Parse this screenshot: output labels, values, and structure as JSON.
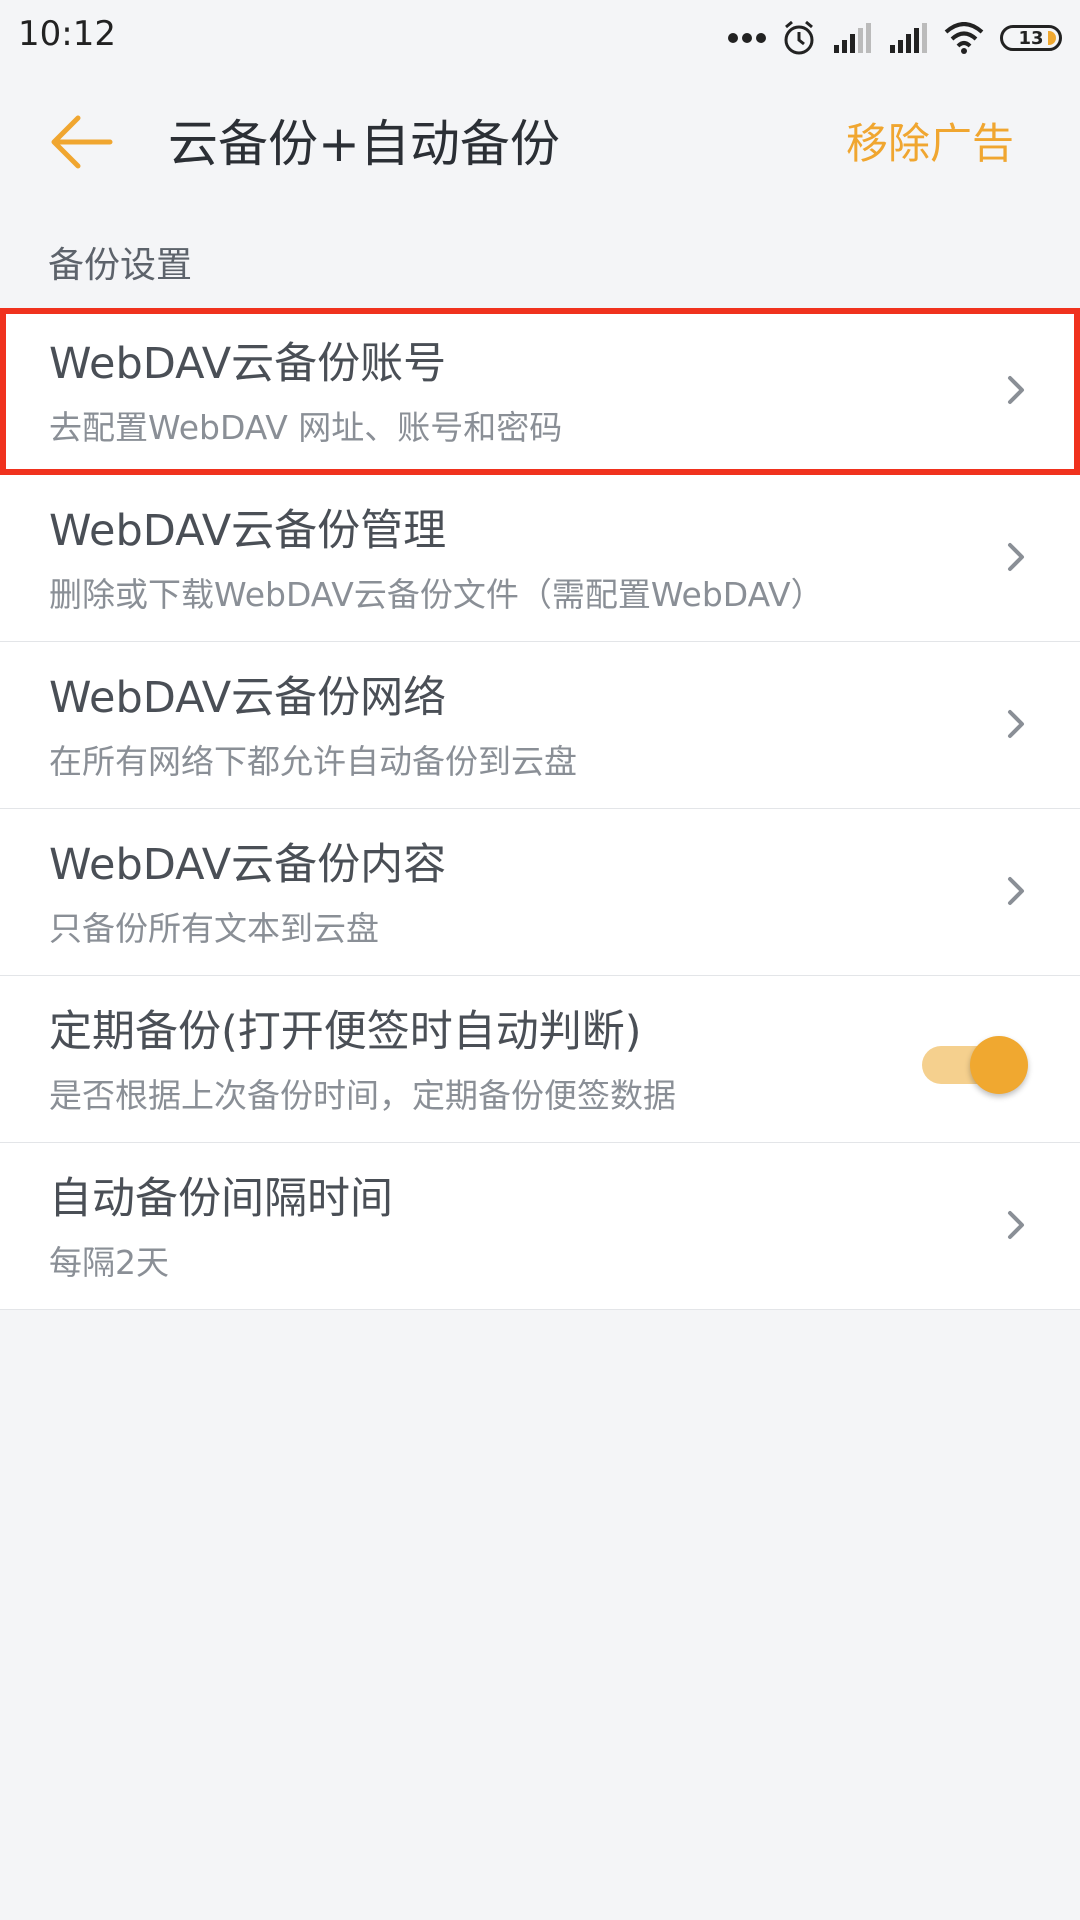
{
  "status_bar": {
    "time": "10:12",
    "battery": "13",
    "icons": [
      "more-dots-icon",
      "alarm-icon",
      "signal-icon",
      "signal-icon",
      "wifi-icon",
      "battery-icon"
    ]
  },
  "app_bar": {
    "title": "云备份+自动备份",
    "action": "移除广告",
    "back_icon": "arrow-left-icon"
  },
  "section": {
    "header": "备份设置"
  },
  "items": [
    {
      "title": "WebDAV云备份账号",
      "subtitle": "去配置WebDAV 网址、账号和密码",
      "control": "chevron",
      "highlighted": true
    },
    {
      "title": "WebDAV云备份管理",
      "subtitle": "删除或下载WebDAV云备份文件（需配置WebDAV）",
      "control": "chevron"
    },
    {
      "title": "WebDAV云备份网络",
      "subtitle": "在所有网络下都允许自动备份到云盘",
      "control": "chevron"
    },
    {
      "title": "WebDAV云备份内容",
      "subtitle": "只备份所有文本到云盘",
      "control": "chevron"
    },
    {
      "title": "定期备份(打开便签时自动判断)",
      "subtitle": "是否根据上次备份时间，定期备份便签数据",
      "control": "toggle",
      "toggle_on": true
    },
    {
      "title": "自动备份间隔时间",
      "subtitle": "每隔2天",
      "control": "chevron"
    }
  ],
  "colors": {
    "accent": "#f0a630",
    "highlight_border": "#f0321e",
    "background": "#f4f5f7"
  }
}
